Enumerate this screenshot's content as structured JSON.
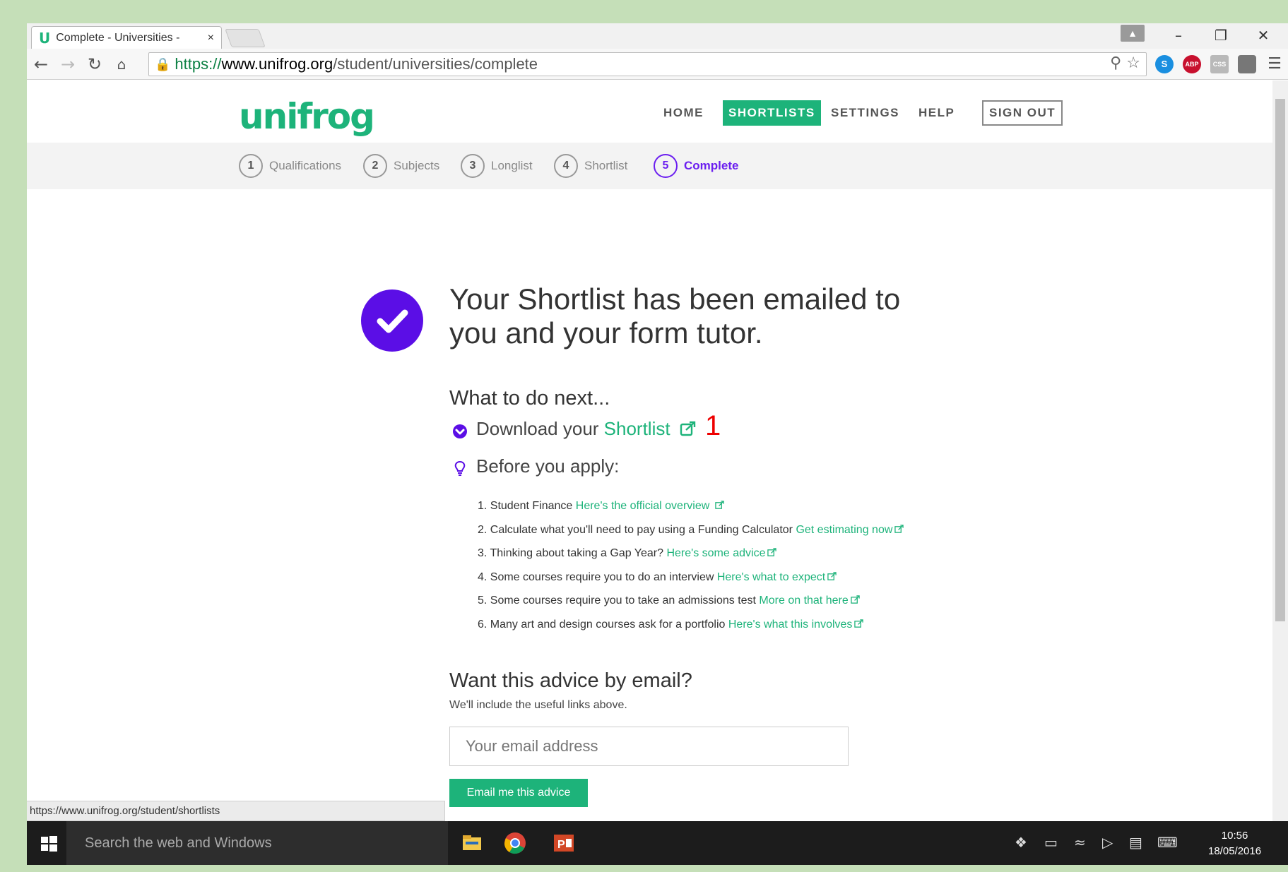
{
  "browser": {
    "tab_title": "Complete - Universities - ",
    "tab_close": "×",
    "url_scheme": "https://",
    "url_host": "www.unifrog.org",
    "url_path": "/student/universities/complete",
    "status_url": "https://www.unifrog.org/student/shortlists",
    "extensions": [
      "S",
      "ABP",
      "CSS"
    ]
  },
  "site": {
    "logo": "unifrog",
    "nav": {
      "home": "HOME",
      "shortlists": "SHORTLISTS",
      "settings": "SETTINGS",
      "help": "HELP",
      "signout": "SIGN OUT"
    },
    "steps": [
      {
        "num": "1",
        "label": "Qualifications"
      },
      {
        "num": "2",
        "label": "Subjects"
      },
      {
        "num": "3",
        "label": "Longlist"
      },
      {
        "num": "4",
        "label": "Shortlist"
      },
      {
        "num": "5",
        "label": "Complete"
      }
    ]
  },
  "main": {
    "headline_line1": "Your Shortlist has been emailed to",
    "headline_line2": "you and your form tutor.",
    "next_heading": "What to do next...",
    "download_prefix": "Download your ",
    "download_link": "Shortlist",
    "annotation": "1",
    "before_apply": "Before you apply:",
    "advice": [
      {
        "text": "1. Student Finance ",
        "link": "Here's the official overview "
      },
      {
        "text": "2. Calculate what you'll need to pay using a Funding Calculator ",
        "link": "Get estimating now"
      },
      {
        "text": "3. Thinking about taking a Gap Year? ",
        "link": "Here's some advice"
      },
      {
        "text": "4. Some courses require you to do an interview ",
        "link": "Here's what to expect"
      },
      {
        "text": "5. Some courses require you to take an admissions test ",
        "link": "More on that here"
      },
      {
        "text": "6. Many art and design courses ask for a portfolio ",
        "link": "Here's what this involves"
      }
    ],
    "email_heading": "Want this advice by email?",
    "email_sub": "We'll include the useful links above.",
    "email_placeholder": "Your email address",
    "email_button": "Email me this advice"
  },
  "taskbar": {
    "search_placeholder": "Search the web and Windows",
    "time": "10:56",
    "date": "18/05/2016"
  },
  "colors": {
    "brand_green": "#1db37a",
    "accent_purple": "#5b0ee6"
  }
}
